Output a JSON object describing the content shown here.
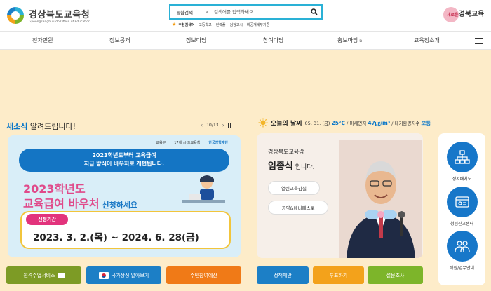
{
  "header": {
    "logo_title": "경상북도교육청",
    "logo_sub": "Gyeongsangbuk-do Office of Education",
    "search_select": "통합검색",
    "search_placeholder": "검색어를 입력하세요",
    "reco_title": "추천검색어",
    "reco_terms": [
      "고등학교",
      "인력풀",
      "검정고시",
      "비공개세부기준"
    ],
    "brand_small": "새로운",
    "brand_text": "경북교육"
  },
  "nav": {
    "items": [
      "전자민원",
      "정보공개",
      "정보마당",
      "참여마당",
      "홍보마당",
      "교육청소개"
    ]
  },
  "notice": {
    "title_highlight": "새소식",
    "title_rest": " 알려드립니다!",
    "pager": "10/13"
  },
  "banner": {
    "orgs": [
      "교육부",
      "17개 시·도교육청",
      "한국장학재단"
    ],
    "badge_line1": "2023학년도부터 교육급여",
    "badge_line2": "지급 방식이 바우처로 개편됩니다.",
    "big1": "2023학년도",
    "big2": "교육급여 바우처",
    "big2_small": " 신청하세요",
    "period_label": "신청기간",
    "period": "2023. 3. 2.(목) ~ 2024. 6. 28(금)"
  },
  "quick_buttons": [
    {
      "label": "원격수업서비스",
      "color": "#7d9b25"
    },
    {
      "label": "국가상징 알아보기",
      "color": "#1c7fc6"
    },
    {
      "label": "주민참여예산",
      "color": "#f07a17"
    }
  ],
  "weather": {
    "title": "오늘의 날씨",
    "date": "05. 31. (금)",
    "temp": "25℃",
    "dust_label": "/ 미세먼지",
    "dust_value": "47㎍/m³",
    "index_label": "/ 대기환경지수",
    "index_value": "보통"
  },
  "superintendent": {
    "sub": "경상북도교육감",
    "name": "임종식",
    "name_suffix": " 입니다.",
    "pills": [
      "열린교육감실",
      "공약&매니페스토"
    ]
  },
  "weather_buttons": [
    {
      "label": "정책제안",
      "color": "#1c7fc6"
    },
    {
      "label": "투표하기",
      "color": "#f3a21b"
    },
    {
      "label": "설문조사",
      "color": "#7db52a"
    }
  ],
  "quick_links": [
    {
      "label": "정서배치도",
      "icon": "org-chart-icon"
    },
    {
      "label": "청렴신고센터",
      "icon": "report-window-icon"
    },
    {
      "label": "직원/업무안내",
      "icon": "staff-icon"
    }
  ],
  "colors": {
    "accent_blue": "#0a77c9",
    "search_border": "#2ab1d6",
    "background": "#fdecc9"
  }
}
